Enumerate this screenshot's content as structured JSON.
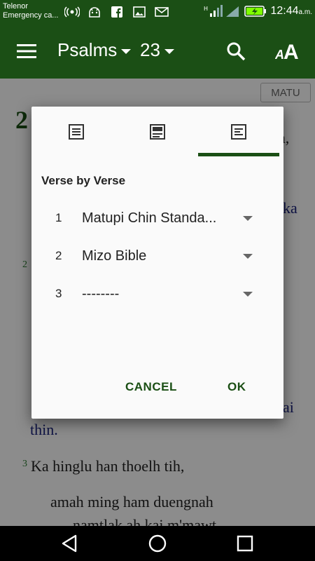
{
  "status_bar": {
    "carrier_line1": "Telenor",
    "carrier_line2": "Emergency ca...",
    "icons": [
      "hotspot-icon",
      "android-icon",
      "facebook-icon",
      "gallery-icon",
      "mail-icon"
    ],
    "time": "12:44",
    "ampm": "a.m."
  },
  "app_bar": {
    "book": "Psalms",
    "chapter": "23",
    "font_button": "A"
  },
  "content": {
    "bible_tag": "MATU",
    "chapter_number": "2",
    "fragments": [
      "a,",
      "ka",
      "ai",
      "thin.",
      "Ka hinglu han thoelh tih,",
      "amah ming ham duengnah",
      "namtlak ah kai m'mawt"
    ],
    "verse_numbers": [
      "2",
      "3"
    ]
  },
  "dialog": {
    "title": "Verse by Verse",
    "rows": [
      {
        "num": "1",
        "value": "Matupi Chin Standa..."
      },
      {
        "num": "2",
        "value": "Mizo Bible"
      },
      {
        "num": "3",
        "value": "--------"
      }
    ],
    "cancel_label": "CANCEL",
    "ok_label": "OK",
    "active_tab": 3
  },
  "colors": {
    "primary": "#1b4f15",
    "verse_text": "#1a237e"
  }
}
